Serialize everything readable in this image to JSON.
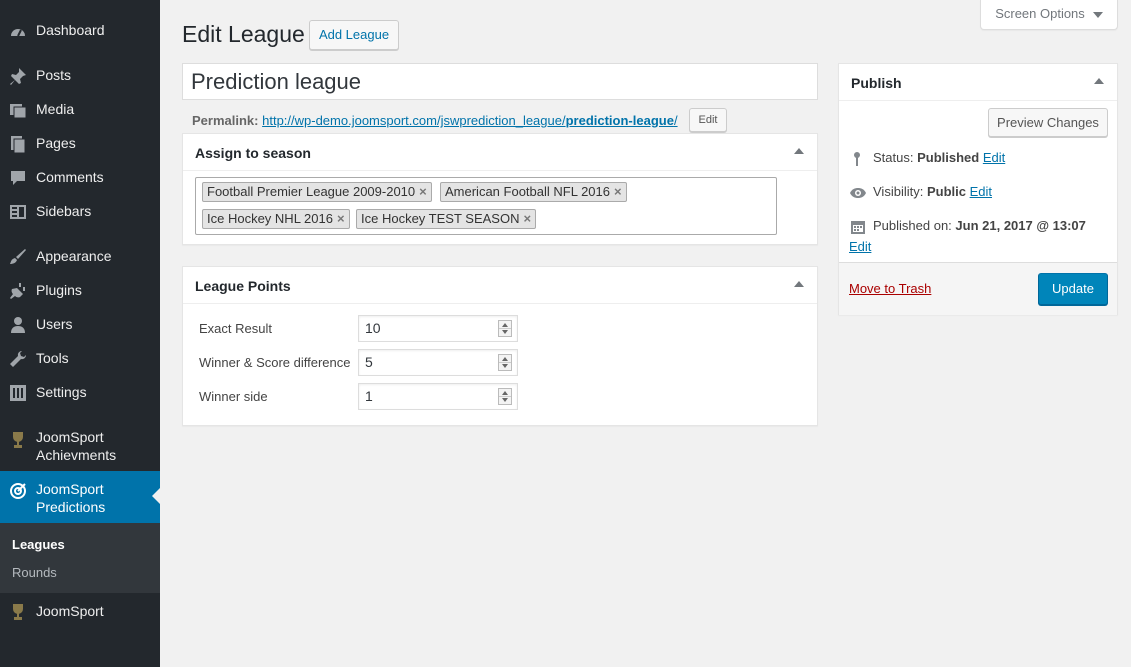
{
  "sidebar": {
    "items": [
      {
        "label": "Dashboard",
        "icon": "dashboard-icon"
      },
      {
        "label": "Posts",
        "icon": "pin-icon"
      },
      {
        "label": "Media",
        "icon": "media-icon"
      },
      {
        "label": "Pages",
        "icon": "pages-icon"
      },
      {
        "label": "Comments",
        "icon": "comment-icon"
      },
      {
        "label": "Sidebars",
        "icon": "sidebars-icon"
      },
      {
        "label": "Appearance",
        "icon": "brush-icon"
      },
      {
        "label": "Plugins",
        "icon": "plug-icon"
      },
      {
        "label": "Users",
        "icon": "user-icon"
      },
      {
        "label": "Tools",
        "icon": "wrench-icon"
      },
      {
        "label": "Settings",
        "icon": "settings-icon"
      },
      {
        "label": "JoomSport Achievments",
        "icon": "trophy-icon"
      },
      {
        "label": "JoomSport Predictions",
        "icon": "target-icon"
      },
      {
        "label": "JoomSport",
        "icon": "trophy-icon"
      }
    ],
    "submenu": [
      "Leagues",
      "Rounds"
    ]
  },
  "header": {
    "title": "Edit League",
    "add_button": "Add League",
    "screen_options": "Screen Options"
  },
  "post": {
    "title": "Prediction league",
    "permalink_label": "Permalink:",
    "permalink_base": "http://wp-demo.joomsport.com/jswprediction_league/",
    "permalink_slug": "prediction-league",
    "permalink_end": "/",
    "permalink_edit": "Edit"
  },
  "season_box": {
    "title": "Assign to season",
    "tags": [
      "Football Premier League 2009-2010",
      "American Football NFL 2016",
      "Ice Hockey NHL 2016",
      "Ice Hockey TEST SEASON"
    ],
    "remove_glyph": "×"
  },
  "points_box": {
    "title": "League Points",
    "rows": [
      {
        "label": "Exact Result",
        "value": "10"
      },
      {
        "label": "Winner & Score difference",
        "value": "5"
      },
      {
        "label": "Winner side",
        "value": "1"
      }
    ]
  },
  "publish": {
    "title": "Publish",
    "preview": "Preview Changes",
    "status_label": "Status:",
    "status_value": "Published",
    "visibility_label": "Visibility:",
    "visibility_value": "Public",
    "published_label": "Published on:",
    "published_value": "Jun 21, 2017 @ 13:07",
    "edit": "Edit",
    "trash": "Move to Trash",
    "update": "Update"
  },
  "colors": {
    "sidebar_bg": "#23282d",
    "active": "#0073aa",
    "primary_button": "#0085ba",
    "trash": "#a00"
  }
}
